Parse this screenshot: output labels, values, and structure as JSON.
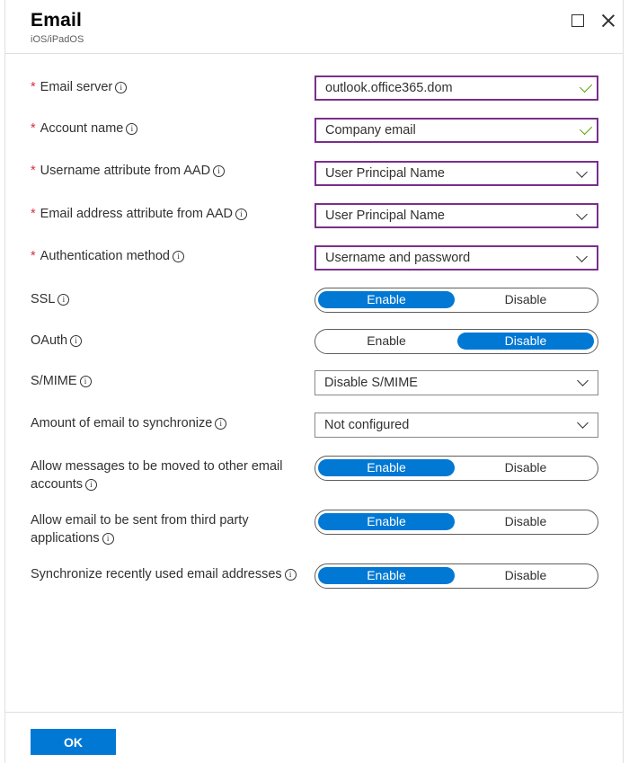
{
  "blade": {
    "title": "Email",
    "subtitle": "iOS/iPadOS"
  },
  "required_mark": "*",
  "info_glyph": "i",
  "fields": {
    "email_server": {
      "label": "Email server",
      "value": "outlook.office365.dom"
    },
    "account_name": {
      "label": "Account name",
      "value": "Company email"
    },
    "username_attr": {
      "label": "Username attribute from AAD",
      "value": "User Principal Name"
    },
    "email_attr": {
      "label": "Email address attribute from AAD",
      "value": "User Principal Name"
    },
    "auth_method": {
      "label": "Authentication method",
      "value": "Username and password"
    },
    "smime": {
      "label": "S/MIME",
      "value": "Disable S/MIME"
    },
    "sync_amount": {
      "label": "Amount of email to synchronize",
      "value": "Not configured"
    }
  },
  "toggles": {
    "ssl": {
      "label": "SSL",
      "on": "Enable",
      "off": "Disable",
      "selected": "Enable"
    },
    "oauth": {
      "label": "OAuth",
      "on": "Enable",
      "off": "Disable",
      "selected": "Disable"
    },
    "move_messages": {
      "label_line1": "Allow messages to be moved to other email",
      "label_line2": "accounts",
      "on": "Enable",
      "off": "Disable",
      "selected": "Enable"
    },
    "third_party": {
      "label_line1": "Allow email to be sent from third party",
      "label_line2": "applications",
      "on": "Enable",
      "off": "Disable",
      "selected": "Enable"
    },
    "sync_recent": {
      "label": "Synchronize recently used email addresses",
      "on": "Enable",
      "off": "Disable",
      "selected": "Enable"
    }
  },
  "footer": {
    "ok_label": "OK"
  },
  "colors": {
    "accent": "#0078d4",
    "required": "#d13438",
    "valid_border": "#7a2f8d",
    "valid_check": "#57a300"
  }
}
